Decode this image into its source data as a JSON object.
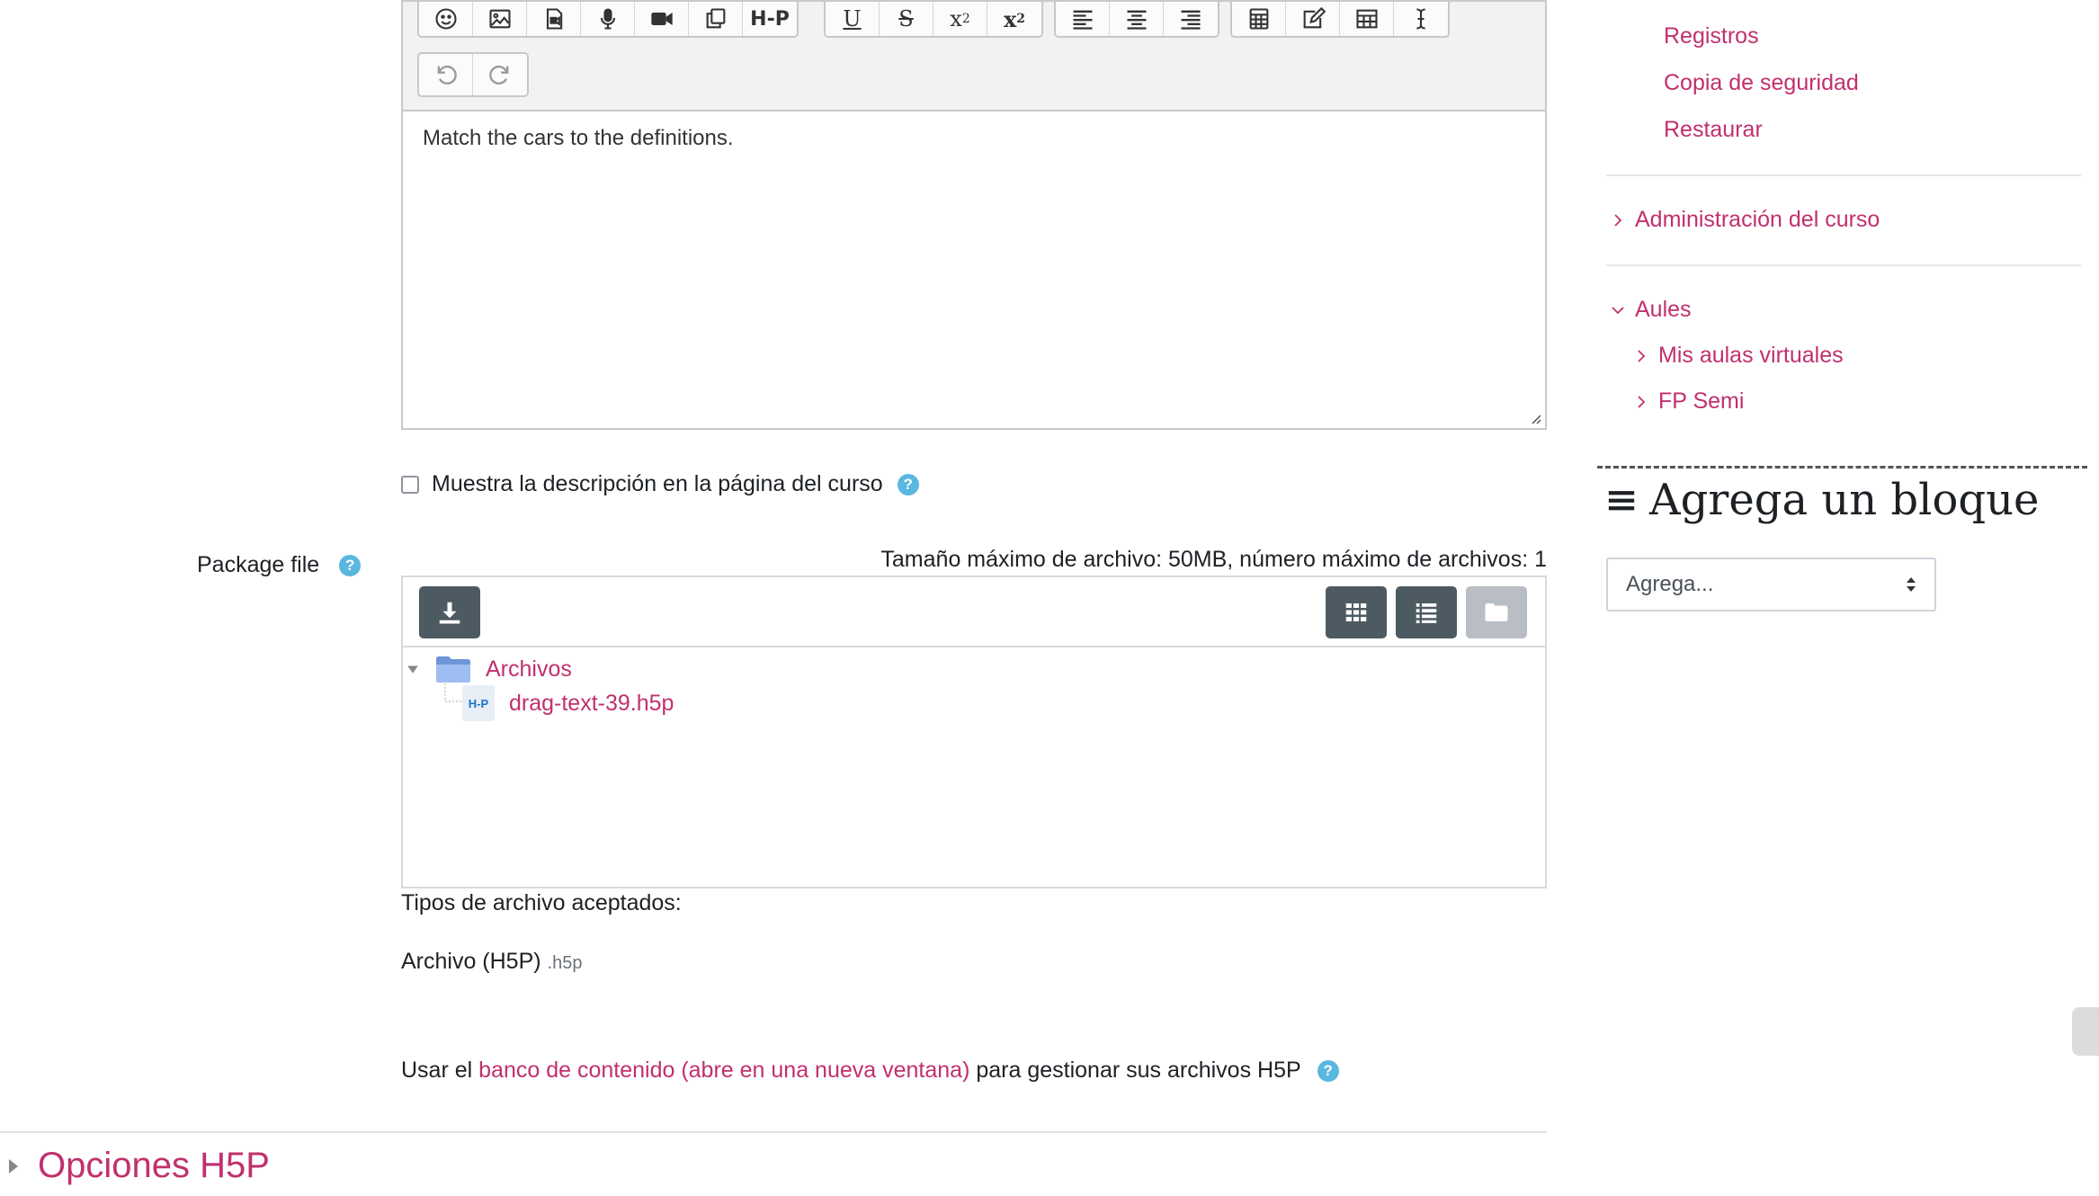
{
  "editor": {
    "content": "Match the cars to the definitions.",
    "toolbar_groups": [
      [
        "emoji-icon",
        "image-icon",
        "media-icon",
        "microphone-icon",
        "video-icon",
        "copy-icon",
        "h5p-icon"
      ],
      [
        "underline-icon",
        "strikethrough-icon",
        "subscript-icon",
        "superscript-icon"
      ],
      [
        "align-left-icon",
        "align-center-icon",
        "align-right-icon"
      ],
      [
        "calculator-icon",
        "edit-icon",
        "table-icon",
        "cursor-icon"
      ]
    ],
    "h5p_label": "H-P",
    "undo_icons": [
      "undo-icon",
      "redo-icon"
    ]
  },
  "show_description": {
    "label": "Muestra la descripción en la página del curso",
    "checked": false
  },
  "package": {
    "label": "Package file",
    "max_size": "Tamaño máximo de archivo: 50MB, número máximo de archivos: 1",
    "folder": "Archivos",
    "file": "drag-text-39.h5p",
    "file_badge": "H-P",
    "accepted_title": "Tipos de archivo aceptados:",
    "accepted_type": "Archivo (H5P)",
    "accepted_ext": ".h5p"
  },
  "content_bank": {
    "prefix": "Usar el",
    "link": "banco de contenido (abre en una nueva ventana)",
    "suffix": "para gestionar sus archivos H5P"
  },
  "section": {
    "title": "Opciones H5P"
  },
  "sidebar": {
    "links_top": [
      "Registros",
      "Copia de seguridad",
      "Restaurar"
    ],
    "course_admin": "Administración del curso",
    "aules": "Aules",
    "aules_items": [
      "Mis aulas virtuales",
      "FP Semi"
    ],
    "add_block_title": "Agrega un bloque",
    "add_block_select": "Agrega..."
  },
  "colors": {
    "accent": "#c1306e",
    "dark_button": "#4e5a62",
    "help": "#5ab7e0"
  }
}
